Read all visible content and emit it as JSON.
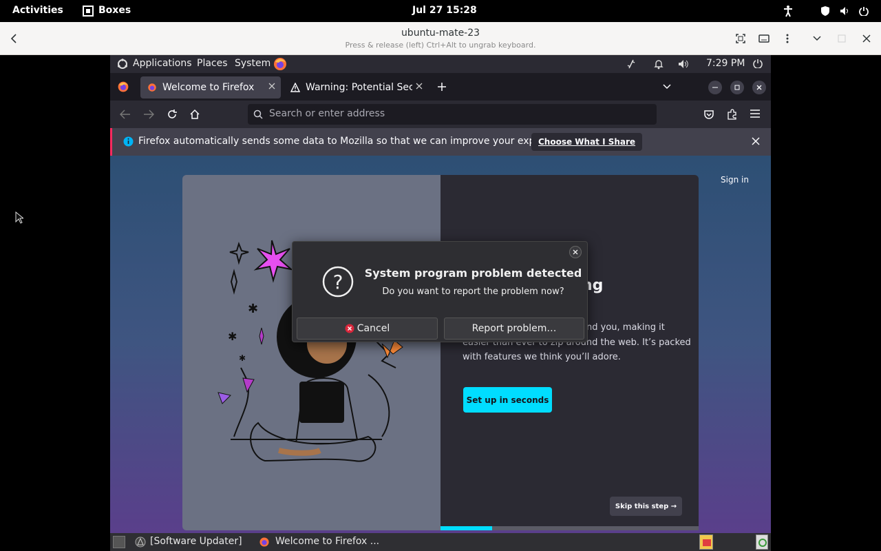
{
  "gnome_bar": {
    "activities": "Activities",
    "app_name": "Boxes",
    "clock": "Jul 27  15:28"
  },
  "boxes_header": {
    "title": "ubuntu-mate-23",
    "subtitle": "Press & release (left) Ctrl+Alt to ungrab keyboard."
  },
  "mate_panel": {
    "menus": [
      "Applications",
      "Places",
      "System"
    ],
    "time": "7:29 PM"
  },
  "firefox": {
    "tabs": [
      {
        "label": "Welcome to Firefox",
        "active": true
      },
      {
        "label": "Warning: Potential Securi",
        "active": false
      }
    ],
    "url_placeholder": "Search or enter address",
    "notification": {
      "text": "Firefox automatically sends some data to Mozilla so that we can improve your experience.",
      "button": "Choose What I Share"
    },
    "page": {
      "sign_in": "Sign in",
      "heading_fragment": "ng",
      "body_line1": "nd you, making it",
      "body_line2": "easier than ever to zip around the web. It’s packed",
      "body_line3": "with features we think you’ll adore.",
      "cta": "Set up in seconds",
      "skip": "Skip this step →",
      "progress": 0.2
    }
  },
  "dialog": {
    "title": "System program problem detected",
    "message": "Do you want to report the problem now?",
    "cancel": "Cancel",
    "report": "Report problem…"
  },
  "taskbar": {
    "items": [
      "[Software Updater]",
      "Welcome to Firefox ..."
    ]
  }
}
